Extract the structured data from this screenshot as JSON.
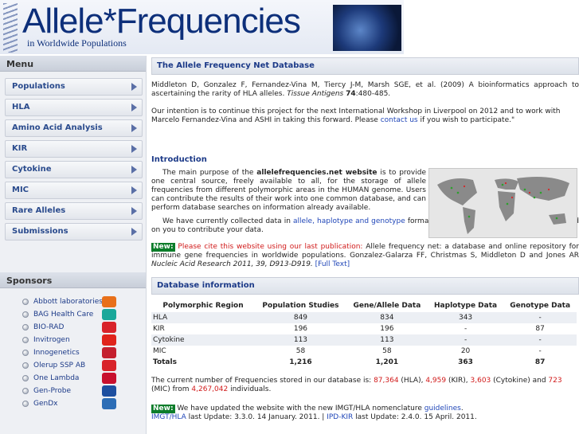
{
  "header": {
    "title": "Allele*Frequencies",
    "subtitle": "in Worldwide Populations"
  },
  "sidebar": {
    "menu_heading": "Menu",
    "items": [
      {
        "label": "Populations"
      },
      {
        "label": "HLA"
      },
      {
        "label": "Amino Acid Analysis"
      },
      {
        "label": "KIR"
      },
      {
        "label": "Cytokine"
      },
      {
        "label": "MIC"
      },
      {
        "label": "Rare Alleles"
      },
      {
        "label": "Submissions"
      }
    ],
    "sponsors_heading": "Sponsors",
    "sponsors": [
      {
        "label": "Abbott laboratories",
        "color": "#e8701a"
      },
      {
        "label": "BAG Health Care",
        "color": "#1aa89a"
      },
      {
        "label": "BIO-RAD",
        "color": "#d8232a"
      },
      {
        "label": "Invitrogen",
        "color": "#e0231b"
      },
      {
        "label": "Innogenetics",
        "color": "#c41f2e"
      },
      {
        "label": "Olerup SSP AB",
        "color": "#d8232a"
      },
      {
        "label": "One Lambda",
        "color": "#c8102e"
      },
      {
        "label": "Gen-Probe",
        "color": "#1d4fa0"
      },
      {
        "label": "GenDx",
        "color": "#2c6db6"
      }
    ]
  },
  "main": {
    "title": "The Allele Frequency Net Database",
    "citation_pre": "Middleton D, Gonzalez F, Fernandez-Vina M, Tiercy J-M, Marsh SGE, et al. (2009) A bioinformatics approach to ascertaining the rarity of HLA alleles. ",
    "citation_journal": "Tissue Antigens",
    "citation_volume": "74",
    "citation_pages": ":480-485.",
    "intention_pre": "Our intention is to continue this project for the next International Workshop in Liverpool on 2012 and to work with Marcelo Fernandez-Vina and ASHI in taking this forward. Please ",
    "contact_link": "contact us",
    "intention_post": " if you wish to participate.\"",
    "intro_heading": "Introduction",
    "intro_pre": "The main purpose of the ",
    "intro_site": "allelefrequencies.net website",
    "intro_post": " is to provide one central source, freely available to all, for the storage of allele frequencies from different polymorphic areas in the HUMAN genome. Users can contribute the results of their work into one common database, and can perform database searches on information already available.",
    "collected_pre": "We have currently collected data in ",
    "collected_links": "allele, haplotype and genotype",
    "collected_post": " format. The success of this website will depend on you to contribute your data.",
    "new_label": "New:",
    "cite_red": "Please cite this website using our last publication:",
    "cite_text": " Allele frequency net: a database and online repository for immune gene frequencies in worldwide populations. Gonzalez-Galarza FF, Christmas S, Middleton D and Jones AR ",
    "cite_journal": "Nucleic Acid Research 2011, 39, D913-D919.",
    "full_text_link": "[Full Text]",
    "db_heading": "Database information",
    "db_columns": [
      "Polymorphic Region",
      "Population Studies",
      "Gene/Allele Data",
      "Haplotype Data",
      "Genotype Data"
    ],
    "db_rows": [
      [
        "HLA",
        "849",
        "834",
        "343",
        "-"
      ],
      [
        "KIR",
        "196",
        "196",
        "-",
        "87"
      ],
      [
        "Cytokine",
        "113",
        "113",
        "-",
        "-"
      ],
      [
        "MIC",
        "58",
        "58",
        "20",
        "-"
      ],
      [
        "Totals",
        "1,216",
        "1,201",
        "363",
        "87"
      ]
    ],
    "freq_pre": "The current number of Frequencies stored in our database is: ",
    "freq_hla": "87,364",
    "freq_hla_label": " (HLA), ",
    "freq_kir": "4,959",
    "freq_kir_label": " (KIR), ",
    "freq_cyt": "3,603",
    "freq_cyt_label": " (Cytokine) and ",
    "freq_mic": "723",
    "freq_mic_label": " (MIC) from ",
    "freq_indiv": "4,267,042",
    "freq_indiv_label": " individuals.",
    "update_text": " We have updated the website with the new IMGT/HLA nomenclature ",
    "guidelines_link": "guidelines",
    "imgt_link": "IMGT/HLA",
    "imgt_update": " last Update: 3.3.0. 14 January. 2011. | ",
    "ipd_link": "IPD-KIR",
    "ipd_update": " last Update: 2.4.0. 15 April. 2011."
  }
}
